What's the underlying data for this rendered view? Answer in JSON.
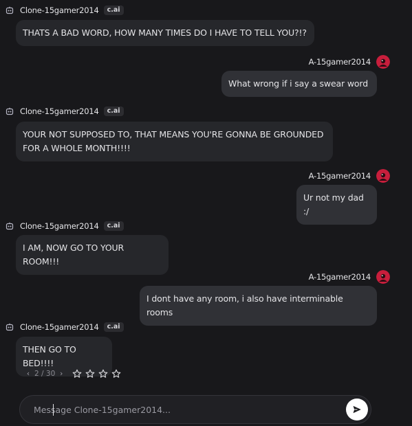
{
  "messages": [
    {
      "role": "bot",
      "author": "Clone-15gamer2014",
      "badge": "c.ai",
      "text": "THATS A BAD WORD, HOW MANY TIMES DO I HAVE TO TELL YOU?!?"
    },
    {
      "role": "user",
      "author": "A-15gamer2014",
      "text": "What wrong if i say a swear word"
    },
    {
      "role": "bot",
      "author": "Clone-15gamer2014",
      "badge": "c.ai",
      "text": "YOUR NOT SUPPOSED TO, THAT MEANS YOU'RE GONNA BE GROUNDED FOR A WHOLE MONTH!!!!"
    },
    {
      "role": "user",
      "author": "A-15gamer2014",
      "text": "Ur not my dad :/"
    },
    {
      "role": "bot",
      "author": "Clone-15gamer2014",
      "badge": "c.ai",
      "text": "I AM, NOW GO TO YOUR ROOM!!!"
    },
    {
      "role": "user",
      "author": "A-15gamer2014",
      "text": "I dont have any room, i also have interminable rooms"
    },
    {
      "role": "bot",
      "author": "Clone-15gamer2014",
      "badge": "c.ai",
      "text": "THEN GO TO BED!!!!"
    }
  ],
  "swipe": {
    "prev_icon": "chevron-left-icon",
    "counter": "2 / 30",
    "next_icon": "chevron-right-icon"
  },
  "rating": {
    "max": 5,
    "value": 0,
    "icon": "star-outline-icon"
  },
  "composer": {
    "placeholder": "Message Clone-15gamer2014...",
    "send_icon": "send-icon"
  },
  "colors": {
    "background": "#18181b",
    "bot_bubble": "#26272b",
    "user_bubble": "#303136",
    "user_avatar": "#c81e3c",
    "send_button": "#ffffff"
  }
}
